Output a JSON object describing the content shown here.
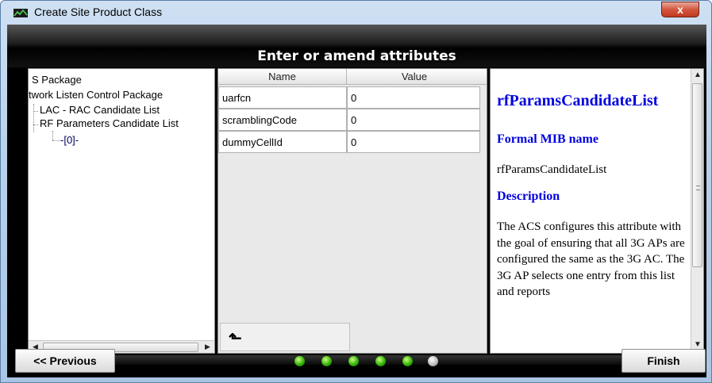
{
  "window": {
    "title": "Create Site Product Class",
    "close_label": "x"
  },
  "header": {
    "title": "Enter or amend attributes"
  },
  "tree": {
    "items": [
      {
        "label": "S Package"
      },
      {
        "label": "twork Listen Control Package"
      },
      {
        "label": "LAC - RAC Candidate List"
      },
      {
        "label": "RF Parameters Candidate List"
      },
      {
        "label": "-[0]-"
      }
    ]
  },
  "table": {
    "columns": [
      "Name",
      "Value"
    ],
    "rows": [
      {
        "name": "uarfcn",
        "value": "0"
      },
      {
        "name": "scramblingCode",
        "value": "0"
      },
      {
        "name": "dummyCellId",
        "value": "0"
      }
    ]
  },
  "description": {
    "title": "rfParamsCandidateList",
    "formal_heading": "Formal MIB name",
    "formal_value": "rfParamsCandidateList",
    "desc_heading": "Description",
    "desc_text": "The ACS configures this attribute with the goal of ensuring that all 3G APs are configured the same as the 3G AC. The 3G AP selects one entry from this list and reports"
  },
  "footer": {
    "previous_label": "<< Previous",
    "finish_label": "Finish",
    "steps_total": 6,
    "steps_complete": 5
  },
  "colors": {
    "accent_blue": "#0000e0",
    "step_complete": "#34b30a",
    "step_pending": "#bdbdbd"
  },
  "icons": {
    "window_icon": "app-icon",
    "up_button": "move-up-arrow-icon"
  }
}
